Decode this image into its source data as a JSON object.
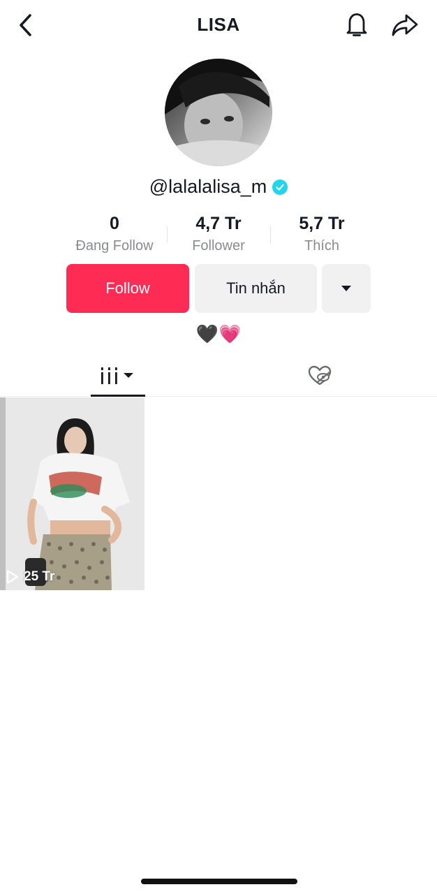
{
  "header": {
    "title": "LISA",
    "back_icon": "chevron-left-icon",
    "bell_icon": "bell-icon",
    "share_icon": "share-arrow-icon"
  },
  "profile": {
    "handle": "@lalalalisa_m",
    "verified": true,
    "avatar_alt": "profile photo"
  },
  "stats": [
    {
      "value": "0",
      "label": "Đang Follow"
    },
    {
      "value": "4,7 Tr",
      "label": "Follower"
    },
    {
      "value": "5,7 Tr",
      "label": "Thích"
    }
  ],
  "actions": {
    "follow_label": "Follow",
    "message_label": "Tin nhắn",
    "more_icon": "caret-down-icon"
  },
  "bio": {
    "heart1": "🖤",
    "heart2": "💗"
  },
  "tabs": {
    "videos_icon": "grid-bars-icon",
    "liked_icon": "heart-hidden-icon"
  },
  "videos": [
    {
      "views": "25 Tr"
    }
  ],
  "colors": {
    "accent": "#fe2c55",
    "verified": "#20d5ec",
    "button_bg": "#f1f1f2",
    "muted_text": "#8a8b91"
  }
}
